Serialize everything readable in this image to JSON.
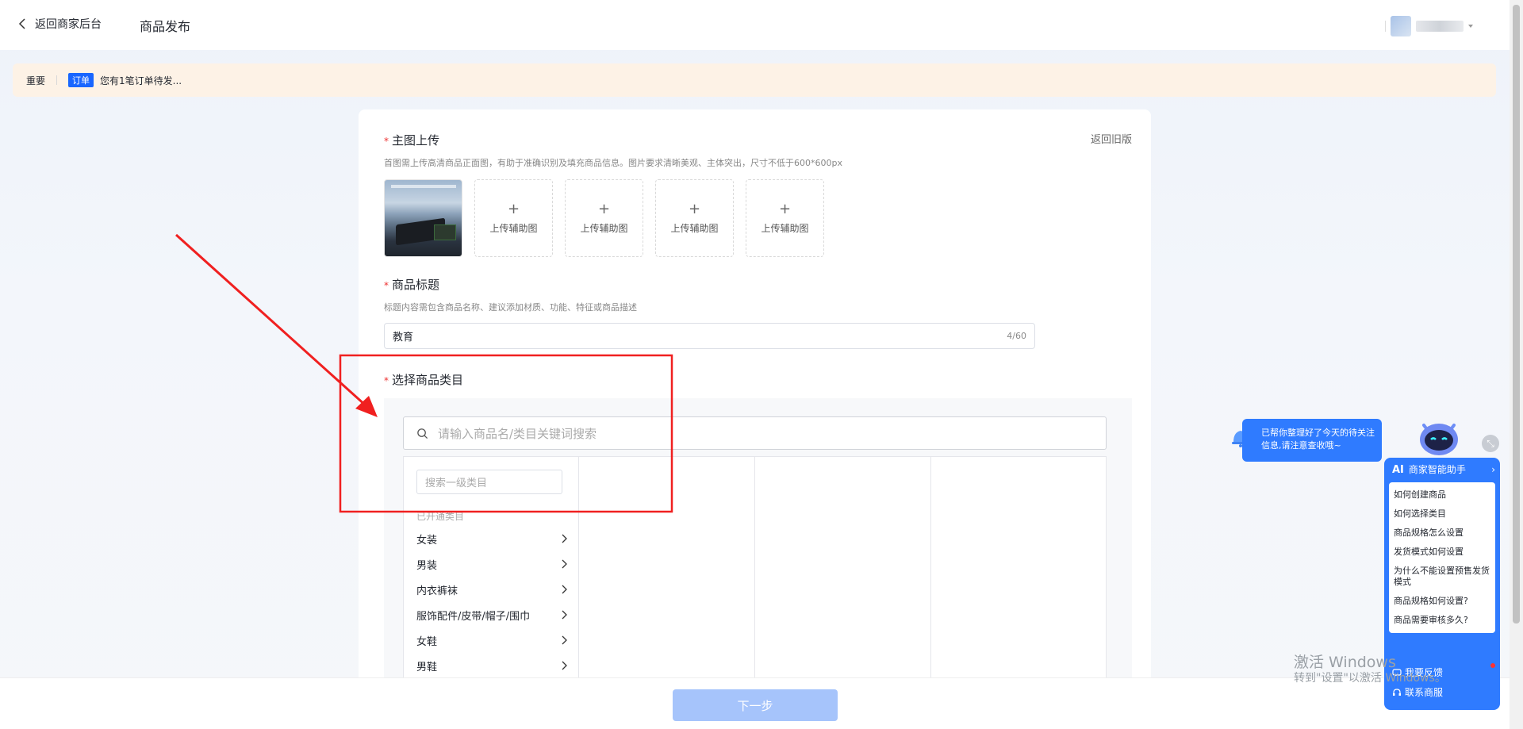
{
  "header": {
    "back_label": "返回商家后台",
    "page_title": "商品发布"
  },
  "notice": {
    "important": "重要",
    "tag": "订单",
    "text": "您有1笔订单待发..."
  },
  "form": {
    "old_version": "返回旧版",
    "main_image": {
      "label": "主图上传",
      "hint": "首图需上传高清商品正面图，有助于准确识别及填充商品信息。图片要求清晰美观、主体突出，尺寸不低于600*600px",
      "upload_label": "上传辅助图"
    },
    "title": {
      "label": "商品标题",
      "hint": "标题内容需包含商品名称、建议添加材质、功能、特征或商品描述",
      "value": "教育",
      "counter": "4/60"
    },
    "category": {
      "label": "选择商品类目",
      "search_placeholder": "请输入商品名/类目关键词搜索",
      "level1_placeholder": "搜索一级类目",
      "opened_label": "已开通类目",
      "items": [
        "女装",
        "男装",
        "内衣裤袜",
        "服饰配件/皮带/帽子/围巾",
        "女鞋",
        "男鞋"
      ]
    }
  },
  "footer": {
    "next_label": "下一步"
  },
  "assistant": {
    "bubble_text": "已帮你整理好了今天的待关注信息,请注意查收哦~",
    "ai_label": "AI",
    "title": "商家智能助手",
    "questions": [
      "如何创建商品",
      "如何选择类目",
      "商品规格怎么设置",
      "发货模式如何设置",
      "为什么不能设置预售发货模式",
      "商品规格如何设置?",
      "商品需要审核多久?"
    ],
    "feedback_label": "我要反馈",
    "contact_label": "联系商服"
  },
  "watermark": {
    "line1": "激活 Windows",
    "line2": "转到\"设置\"以激活 Windows。"
  },
  "colors": {
    "primary": "#1966ff",
    "assistant": "#2f7bff",
    "annotation": "#f02020",
    "notice_bg": "#fdf2e6",
    "disabled_button": "#a6c4fb"
  }
}
